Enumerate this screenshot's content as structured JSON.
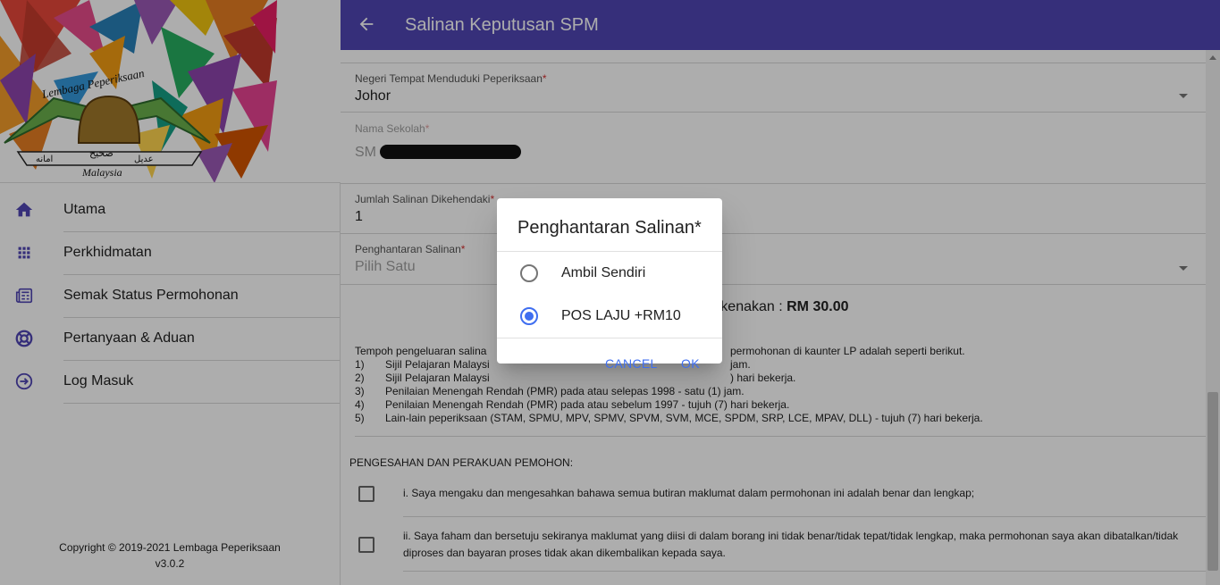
{
  "app": {
    "title": "Salinan Keputusan SPM",
    "colors": {
      "primary": "#5046b4",
      "accent": "#3f6ef0",
      "required": "#d32f2f"
    }
  },
  "logo": {
    "text_top": "Lembaga Peperiksaan",
    "text_bottom": "Malaysia",
    "ribbon_center": "صحيح",
    "ribbon_left": "امانه",
    "ribbon_right": "عديل"
  },
  "sidebar": {
    "items": [
      {
        "label": "Utama",
        "icon": "home-icon"
      },
      {
        "label": "Perkhidmatan",
        "icon": "apps-grid-icon"
      },
      {
        "label": "Semak Status Permohonan",
        "icon": "newspaper-icon"
      },
      {
        "label": "Pertanyaan & Aduan",
        "icon": "lifebuoy-icon"
      },
      {
        "label": "Log Masuk",
        "icon": "login-icon"
      }
    ],
    "copyright": "Copyright © 2019-2021 Lembaga Peperiksaan",
    "version": "v3.0.2"
  },
  "form": {
    "negeri": {
      "label": "Negeri Tempat Menduduki Peperiksaan",
      "value": "Johor"
    },
    "sekolah": {
      "label": "Nama Sekolah",
      "value": "SM"
    },
    "jumlah": {
      "label": "Jumlah Salinan Dikehendaki",
      "value": "1"
    },
    "penghantaran": {
      "label": "Penghantaran Salinan",
      "placeholder": "Pilih Satu"
    },
    "required_mark": "*",
    "fee_prefix": "g dikenakan : ",
    "fee_amount": "RM 30.00",
    "notes": {
      "intro": "Tempoh pengeluaran salina",
      "intro_tail": "permohonan di kaunter LP adalah seperti berikut.",
      "items": [
        {
          "num": "1)",
          "text": "Sijil Pelajaran Malaysi",
          "tail": "jam."
        },
        {
          "num": "2)",
          "text": "Sijil Pelajaran Malaysi",
          "tail": ") hari bekerja."
        },
        {
          "num": "3)",
          "text": "Penilaian Menengah Rendah (PMR) pada atau selepas 1998 - satu (1) jam.",
          "tail": ""
        },
        {
          "num": "4)",
          "text": "Penilaian Menengah Rendah (PMR) pada atau sebelum 1997 - tujuh (7) hari bekerja.",
          "tail": ""
        },
        {
          "num": "5)",
          "text": "Lain-lain peperiksaan (STAM, SPMU, MPV, SPMV, SPVM, SVM, MCE, SPDM, SRP, LCE, MPAV, DLL) - tujuh (7) hari bekerja.",
          "tail": ""
        }
      ]
    },
    "pengesahan_title": "PENGESAHAN DAN PERAKUAN PEMOHON:",
    "declarations": [
      "i. Saya mengaku dan mengesahkan bahawa semua butiran maklumat dalam permohonan ini adalah benar dan lengkap;",
      "ii. Saya faham dan bersetuju sekiranya maklumat yang diisi di dalam borang ini tidak benar/tidak tepat/tidak lengkap, maka permohonan saya akan dibatalkan/tidak diproses dan bayaran proses tidak akan dikembalikan kepada saya."
    ]
  },
  "dialog": {
    "title": "Penghantaran Salinan*",
    "options": [
      {
        "label": "Ambil Sendiri",
        "selected": false
      },
      {
        "label": "POS LAJU +RM10",
        "selected": true
      }
    ],
    "cancel": "CANCEL",
    "ok": "OK"
  }
}
